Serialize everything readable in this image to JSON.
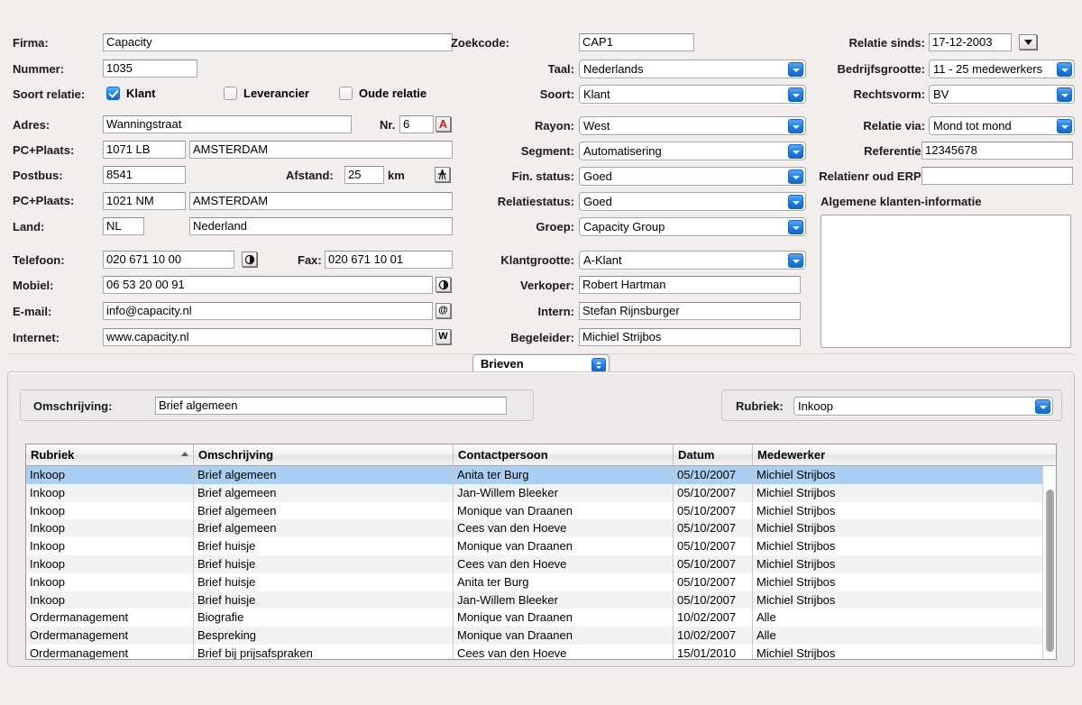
{
  "left_column": {
    "fields": [
      {
        "label": "Firma:",
        "value": "Capacity"
      },
      {
        "label": "Nummer:",
        "value": "1035"
      },
      {
        "label": "Adres:",
        "value": "Wanningstraat"
      },
      {
        "label": "PC+Plaats:",
        "value": "1071 LB"
      },
      {
        "label": "Postbus:",
        "value": "8541"
      },
      {
        "label": "PC+Plaats:",
        "value": "1021 NM"
      },
      {
        "label": "Land:",
        "value": "NL"
      },
      {
        "label": "Telefoon:",
        "value": "020 671 10 00"
      },
      {
        "label": "Mobiel:",
        "value": "06 53 20 00 91"
      },
      {
        "label": "E-mail:",
        "value": "info@capacity.nl"
      },
      {
        "label": "Internet:",
        "value": "www.capacity.nl"
      }
    ],
    "soort_relatie_label": "Soort relatie:",
    "checkboxes": [
      {
        "label": "Klant",
        "checked": true
      },
      {
        "label": "Leverancier",
        "checked": false
      },
      {
        "label": "Oude relatie",
        "checked": false
      }
    ],
    "nr_label": "Nr.",
    "nr_value": "6",
    "address_icon": "A",
    "plaats1": "AMSTERDAM",
    "afstand_label": "Afstand:",
    "afstand_value": "25",
    "afstand_unit": "km",
    "route_icon": "route-icon",
    "plaats2": "AMSTERDAM",
    "land_name": "Nederland",
    "phone_icon": "phone-icon",
    "fax_label": "Fax:",
    "fax_value": "020 671 10 01",
    "mobile_icon": "phone-icon",
    "email_icon": "@",
    "web_icon": "W"
  },
  "middle_column": {
    "fields": [
      {
        "label": "Zoekcode:",
        "value": "CAP1",
        "type": "text"
      },
      {
        "label": "Taal:",
        "value": "Nederlands",
        "type": "combo"
      },
      {
        "label": "Soort:",
        "value": "Klant",
        "type": "combo"
      },
      {
        "label": "Rayon:",
        "value": "West",
        "type": "combo"
      },
      {
        "label": "Segment:",
        "value": "Automatisering",
        "type": "combo"
      },
      {
        "label": "Fin. status:",
        "value": "Goed",
        "type": "combo"
      },
      {
        "label": "Relatiestatus:",
        "value": "Goed",
        "type": "combo"
      },
      {
        "label": "Groep:",
        "value": "Capacity Group",
        "type": "combo"
      },
      {
        "label": "Klantgrootte:",
        "value": "A-Klant",
        "type": "combo"
      },
      {
        "label": "Verkoper:",
        "value": "Robert Hartman",
        "type": "text"
      },
      {
        "label": "Intern:",
        "value": "Stefan Rijnsburger",
        "type": "text"
      },
      {
        "label": "Begeleider:",
        "value": "Michiel Strijbos",
        "type": "text"
      }
    ]
  },
  "right_column": {
    "fields": [
      {
        "label": "Relatie sinds:",
        "value": "17-12-2003",
        "type": "date"
      },
      {
        "label": "Bedrijfsgrootte:",
        "value": "11 - 25 medewerkers",
        "type": "combo"
      },
      {
        "label": "Rechtsvorm:",
        "value": "BV",
        "type": "combo"
      },
      {
        "label": "Relatie via:",
        "value": "Mond tot mond",
        "type": "combo"
      },
      {
        "label": "Referentie:",
        "value": "12345678",
        "type": "text"
      },
      {
        "label": "Relatienr oud ERP:",
        "value": "",
        "type": "text"
      }
    ],
    "notes_title": "Algemene klanten-informatie",
    "notes_value": ""
  },
  "tab_selector": {
    "label": "Brieven"
  },
  "detail": {
    "omschrijving_label": "Omschrijving:",
    "omschrijving_value": "Brief algemeen",
    "rubriek_label": "Rubriek:",
    "rubriek_value": "Inkoop"
  },
  "table": {
    "columns": [
      {
        "key": "rubriek",
        "label": "Rubriek",
        "sorted": true,
        "sort_dir": "asc"
      },
      {
        "key": "omschrijving",
        "label": "Omschrijving",
        "sorted": false
      },
      {
        "key": "contactpersoon",
        "label": "Contactpersoon",
        "sorted": false
      },
      {
        "key": "datum",
        "label": "Datum",
        "sorted": false
      },
      {
        "key": "medewerker",
        "label": "Medewerker",
        "sorted": false
      }
    ],
    "rows": [
      {
        "rubriek": "Inkoop",
        "omschrijving": "Brief algemeen",
        "contactpersoon": "Anita ter Burg",
        "datum": "05/10/2007",
        "medewerker": "Michiel Strijbos",
        "selected": true
      },
      {
        "rubriek": "Inkoop",
        "omschrijving": "Brief algemeen",
        "contactpersoon": "Jan-Willem Bleeker",
        "datum": "05/10/2007",
        "medewerker": "Michiel Strijbos",
        "selected": false
      },
      {
        "rubriek": "Inkoop",
        "omschrijving": "Brief algemeen",
        "contactpersoon": "Monique van Draanen",
        "datum": "05/10/2007",
        "medewerker": "Michiel Strijbos",
        "selected": false
      },
      {
        "rubriek": "Inkoop",
        "omschrijving": "Brief algemeen",
        "contactpersoon": "Cees van den Hoeve",
        "datum": "05/10/2007",
        "medewerker": "Michiel Strijbos",
        "selected": false
      },
      {
        "rubriek": "Inkoop",
        "omschrijving": "Brief huisje",
        "contactpersoon": "Monique van Draanen",
        "datum": "05/10/2007",
        "medewerker": "Michiel Strijbos",
        "selected": false
      },
      {
        "rubriek": "Inkoop",
        "omschrijving": "Brief huisje",
        "contactpersoon": "Cees van den Hoeve",
        "datum": "05/10/2007",
        "medewerker": "Michiel Strijbos",
        "selected": false
      },
      {
        "rubriek": "Inkoop",
        "omschrijving": "Brief huisje",
        "contactpersoon": "Anita ter Burg",
        "datum": "05/10/2007",
        "medewerker": "Michiel Strijbos",
        "selected": false
      },
      {
        "rubriek": "Inkoop",
        "omschrijving": "Brief huisje",
        "contactpersoon": "Jan-Willem Bleeker",
        "datum": "05/10/2007",
        "medewerker": "Michiel Strijbos",
        "selected": false
      },
      {
        "rubriek": "Ordermanagement",
        "omschrijving": "Biografie",
        "contactpersoon": "Monique van Draanen",
        "datum": "10/02/2007",
        "medewerker": "Alle",
        "selected": false
      },
      {
        "rubriek": "Ordermanagement",
        "omschrijving": "Bespreking",
        "contactpersoon": "Monique van Draanen",
        "datum": "10/02/2007",
        "medewerker": "Alle",
        "selected": false
      },
      {
        "rubriek": "Ordermanagement",
        "omschrijving": "Brief bij prijsafspraken",
        "contactpersoon": "Cees van den Hoeve",
        "datum": "15/01/2010",
        "medewerker": "Michiel Strijbos",
        "selected": false
      }
    ]
  },
  "colors": {
    "accent": "#1f7fe0",
    "selection": "#aacff4",
    "window_bg": "#f2eeee",
    "panel_bg": "#eceaea"
  }
}
